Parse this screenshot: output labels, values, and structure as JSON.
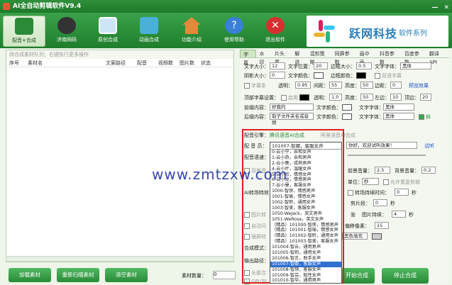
{
  "window": {
    "title": "AI全自动剪辑软件V9.4",
    "minimize": "—",
    "close": "✕"
  },
  "toolbar": {
    "items": [
      {
        "label": "配音+合成",
        "active": true
      },
      {
        "label": "济南网码"
      },
      {
        "label": "原创合成"
      },
      {
        "label": "动画合成"
      },
      {
        "label": "功能介绍"
      },
      {
        "label": "使用帮助"
      },
      {
        "label": "退出软件"
      }
    ]
  },
  "logo": {
    "brand": "跃网科技",
    "sub": "软件系列"
  },
  "left": {
    "hint": "待合成素材队列：右键执行更多操作",
    "columns": [
      "序号",
      "素材名",
      "文案路径",
      "配音",
      "视频数",
      "图片数",
      "状态"
    ]
  },
  "bottom": {
    "load": "加载素材",
    "rescan": "重新扫描素材",
    "clear": "清空素材",
    "count_label": "素材数量：",
    "count_value": "0"
  },
  "tabs": [
    "字幕",
    "水印",
    "片头尾",
    "解说",
    "混剪策略",
    "同屏参数",
    "画中画",
    "抖音参数",
    "百度参数",
    "翻译API"
  ],
  "subtitle": {
    "font_size_l": "文字大小：",
    "font_size": "12",
    "pos_l": "文字位置：",
    "pos": "20",
    "border_size_l": "边框大小：",
    "border": "0.5",
    "font_l": "文字字体：",
    "font": "黑体",
    "shadow_l": "阴影大小：",
    "shadow": "0",
    "color_l": "文字颜色：",
    "bcolor_l": "边框颜色：",
    "bilingual": "双语字幕",
    "bar_l": "字幕条",
    "trans_l": "透明：",
    "trans": "0.95",
    "width_l": "间距：",
    "width": "55",
    "height_l": "高度：",
    "height": "50",
    "margin_l": "边距：",
    "margin": "0",
    "preview": "预览效果",
    "top_l": "顶部字幕设置：",
    "enable": "启用",
    "trans2": "1.0",
    "height2": "50",
    "left_l": "左边：",
    "left": "10",
    "top2_l": "顶边：",
    "top2": "20",
    "pre_l": "前缀内容：",
    "pre": "好我的",
    "font2_l": "文字颜色：",
    "font2": "黑体",
    "post_l": "后缀内容：",
    "post": "取子文件夹名或音频",
    "font3": "黑体",
    "italic": "斜"
  },
  "dub": {
    "engine_l": "配音引擎：",
    "engine_a": "腾讯语音AI合成",
    "engine_b": "阿里语音AI合成",
    "voice_l": "配 音 员：",
    "voice": "101007-智娜，客服女声",
    "lang_l": "配音语速：",
    "text": "你好，欢迎试听效果！",
    "try": "试听",
    "bg_l": "背景音",
    "vol_l": "前景音量：",
    "vol": "2.5",
    "bgvol_l": "背景音量：",
    "bgvol": "0.2",
    "unit_l": "单位：",
    "unit": "秒",
    "allow": "允许重复剪辑",
    "ai_l": "AI转场特效",
    "dur_l": "转场持续时间：",
    "dur": "0",
    "sec": "秒",
    "cut_l": "剪片段：",
    "cut": "0",
    "sec2": "秒",
    "img_l": "图片转",
    "img2_l": "张",
    "img_dur_l": "图片持续：",
    "img_dur": "4",
    "sec3": "秒",
    "auto_l": "自动问",
    "pixel_l": "偏移像素：",
    "pixel": "15",
    "mirror_l": "镜屏转",
    "fill": "黑色填充",
    "mode_l": "合成模式：",
    "path_l": "输出路径：",
    "all_l": "全部合",
    "gpu_l": "GPU加",
    "start": "开始合成",
    "stop": "停止合成"
  },
  "dropdown": {
    "items": [
      "0-云小宁，亲和女声",
      "1-云小奇，亲和男声",
      "2-云小晚，成熟男声",
      "4-云小叶，温暖女声",
      "5-云小欣，情感女声",
      "6-云小龙，情感男声",
      "7-云小曼，客服女声",
      "1000-智侠，情感男声",
      "1001-智瑜，情感女声",
      "1002-智聆，通用女声",
      "1003-智美，客服女声",
      "1050-WeJack，英文男声",
      "1051-WeRose，英文女声",
      "（精品）101000-智侠，情感男声",
      "（精品）101001-智瑜，情感女声",
      "（精品）101002-智聆，通用女声",
      "（精品）101003-智美，客服女声",
      "101004-智云，通用男声",
      "101005-智莉，通用女声",
      "101006-智言，助手女声",
      "101007-智娜，客服女声",
      "101008-智琪，客服女声",
      "101009-智芸，知性女声",
      "101010-智华，通用男声"
    ],
    "highlight": 20
  },
  "watermark": "www.zmtzxw.com"
}
